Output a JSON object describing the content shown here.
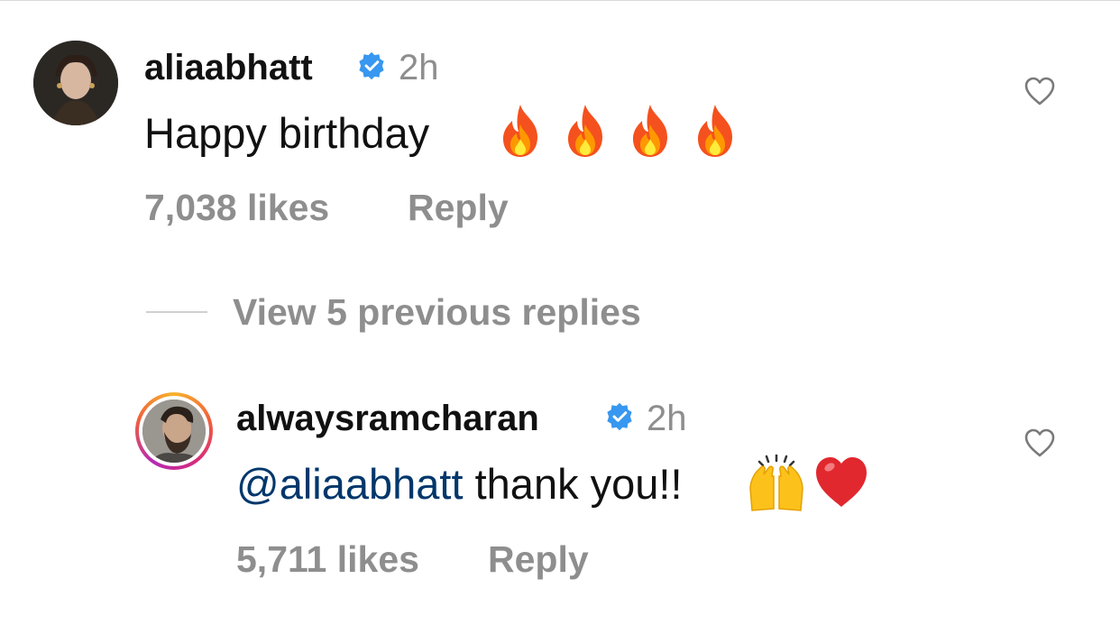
{
  "comments": [
    {
      "username": "aliaabhatt",
      "time": "2h",
      "text": "Happy birthday",
      "emojis": [
        "fire-emoji",
        "fire-emoji",
        "fire-emoji",
        "fire-emoji"
      ],
      "likes": "7,038 likes",
      "reply": "Reply",
      "verified": true
    }
  ],
  "thread": {
    "view_replies": "View 5 previous replies"
  },
  "replies": [
    {
      "username": "alwaysramcharan",
      "time": "2h",
      "mention": "@aliaabhatt",
      "text": " thank you!!",
      "emojis": [
        "raising-hands-emoji",
        "red-heart-emoji"
      ],
      "likes": "5,711 likes",
      "reply": "Reply",
      "verified": true
    }
  ],
  "colors": {
    "verified": "#3897f0",
    "mention": "#00376b",
    "secondary_text": "#8e8e8e"
  }
}
